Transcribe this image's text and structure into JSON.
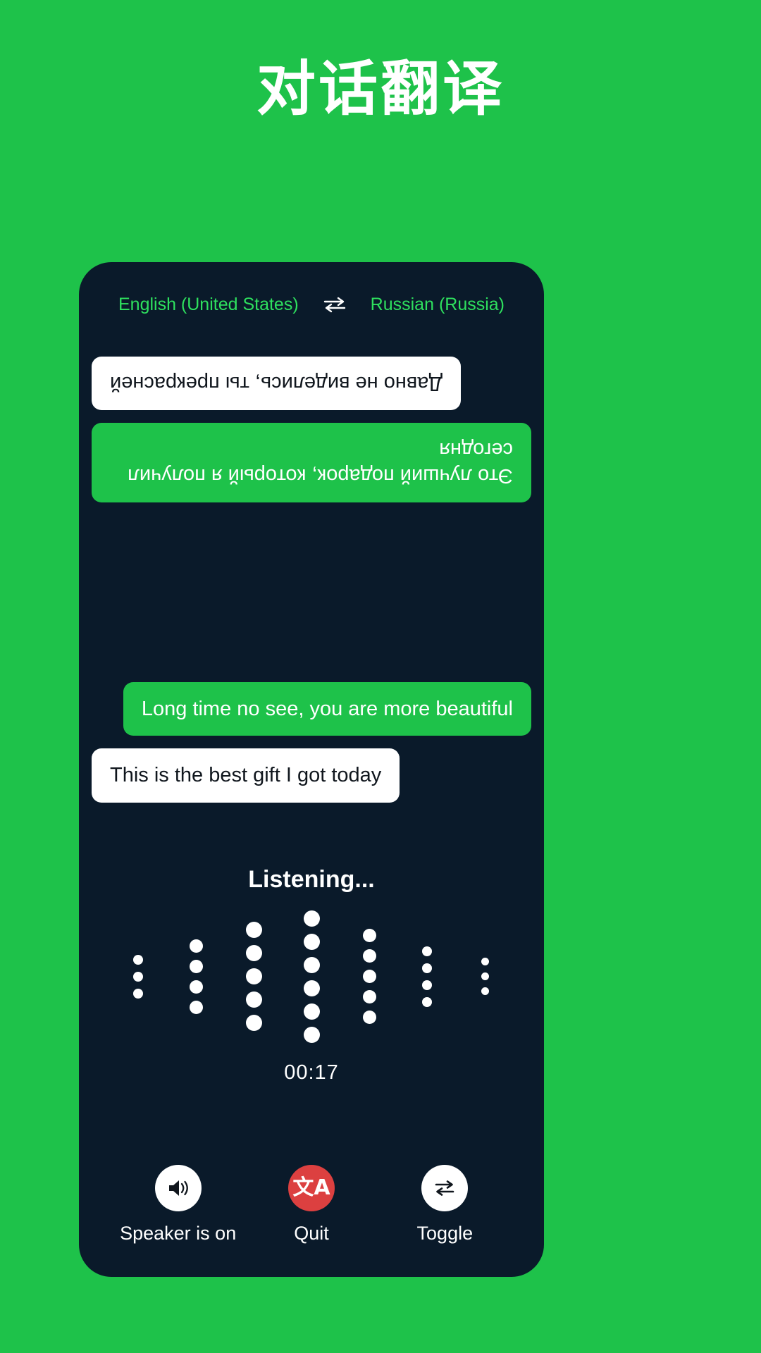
{
  "page": {
    "title": "对话翻译",
    "background_color": "#1ec24a",
    "panel_color": "#0a1a2a"
  },
  "language_bar": {
    "source_language": "English (United States)",
    "swap_icon": "swap-horizontal-icon",
    "target_language": "Russian (Russia)",
    "accent_color": "#2ee05e"
  },
  "conversation": {
    "foreign_pane": {
      "rotated": true,
      "messages": [
        {
          "text": "Это лучший подарок, который я получил сегодня",
          "style": "green",
          "align": "left"
        },
        {
          "text": "Давно не виделись, ты прекрасней",
          "style": "white",
          "align": "right"
        }
      ]
    },
    "local_pane": {
      "rotated": false,
      "messages": [
        {
          "text": "Long time no see, you are more beautiful",
          "style": "green",
          "align": "right"
        },
        {
          "text": "This is the best gift I got today",
          "style": "white",
          "align": "left"
        }
      ]
    }
  },
  "listening": {
    "status_label": "Listening...",
    "timer": "00:17",
    "waveform": {
      "dot_color": "#ffffff",
      "columns": [
        {
          "dots": 3,
          "size": 14
        },
        {
          "dots": 4,
          "size": 19
        },
        {
          "dots": 5,
          "size": 23
        },
        {
          "dots": 6,
          "size": 23
        },
        {
          "dots": 5,
          "size": 19
        },
        {
          "dots": 4,
          "size": 14
        },
        {
          "dots": 3,
          "size": 11
        }
      ]
    }
  },
  "controls": [
    {
      "label": "Speaker is on",
      "icon": "speaker-on-icon",
      "circle_color": "#ffffff"
    },
    {
      "label": "Quit",
      "icon": "translate-icon",
      "circle_color": "#dc4040"
    },
    {
      "label": "Toggle",
      "icon": "swap-loop-icon",
      "circle_color": "#ffffff"
    }
  ]
}
